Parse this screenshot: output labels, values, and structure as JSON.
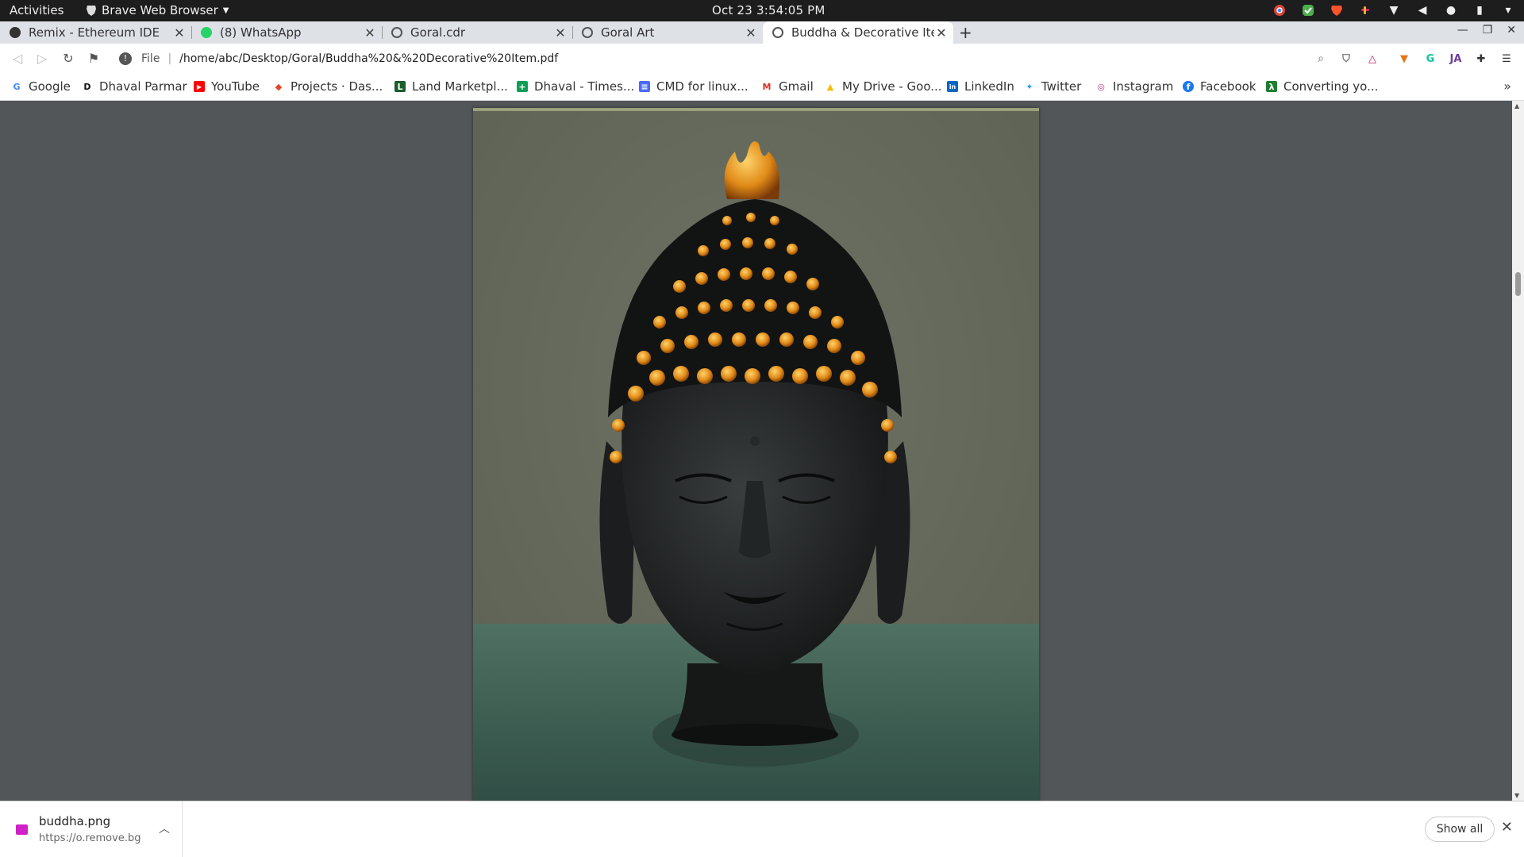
{
  "system": {
    "activities": "Activities",
    "app_name": "Brave Web Browser",
    "clock": "Oct 23  3:54:05 PM"
  },
  "tabs": [
    {
      "label": "Remix - Ethereum IDE",
      "icon": "remix-icon",
      "color": "#333333"
    },
    {
      "label": "(8) WhatsApp",
      "icon": "whatsapp-icon",
      "color": "#25d366"
    },
    {
      "label": "Goral.cdr",
      "icon": "globe-icon",
      "color": "#555555"
    },
    {
      "label": "Goral Art",
      "icon": "globe-icon",
      "color": "#555555"
    },
    {
      "label": "Buddha & Decorative Item",
      "icon": "globe-icon",
      "color": "#555555"
    }
  ],
  "address": {
    "scheme": "File",
    "url": "/home/abc/Desktop/Goral/Buddha%20&%20Decorative%20Item.pdf"
  },
  "bookmarks": [
    {
      "label": "Google",
      "icon": "google-icon",
      "color": "#4285f4",
      "glyph": "G"
    },
    {
      "label": "Dhaval Parmar",
      "icon": "d-icon",
      "color": "#111111",
      "glyph": "D"
    },
    {
      "label": "YouTube",
      "icon": "youtube-icon",
      "color": "#ff0000",
      "glyph": "▶"
    },
    {
      "label": "Projects · Das...",
      "icon": "gitlab-icon",
      "color": "#e24329",
      "glyph": "◆"
    },
    {
      "label": "Land Marketpl...",
      "icon": "land-icon",
      "color": "#1a5c2a",
      "glyph": "L"
    },
    {
      "label": "Dhaval - Times...",
      "icon": "sheets-icon",
      "color": "#0f9d58",
      "glyph": "+"
    },
    {
      "label": "CMD for linux...",
      "icon": "docs-icon",
      "color": "#4a6cf7",
      "glyph": "≡"
    },
    {
      "label": "Gmail",
      "icon": "gmail-icon",
      "color": "#d93025",
      "glyph": "M"
    },
    {
      "label": "My Drive - Goo...",
      "icon": "drive-icon",
      "color": "#fbbc04",
      "glyph": "▲"
    },
    {
      "label": "LinkedIn",
      "icon": "linkedin-icon",
      "color": "#0a66c2",
      "glyph": "in"
    },
    {
      "label": "Twitter",
      "icon": "twitter-icon",
      "color": "#1da1f2",
      "glyph": "✦"
    },
    {
      "label": "Instagram",
      "icon": "instagram-icon",
      "color": "#c13584",
      "glyph": "◎"
    },
    {
      "label": "Facebook",
      "icon": "facebook-icon",
      "color": "#1877f2",
      "glyph": "f"
    },
    {
      "label": "Converting yo...",
      "icon": "converter-icon",
      "color": "#1e7d32",
      "glyph": "λ"
    }
  ],
  "download": {
    "filename": "buddha.png",
    "source": "https://o.remove.bg"
  },
  "shelf": {
    "show_all": "Show all"
  }
}
